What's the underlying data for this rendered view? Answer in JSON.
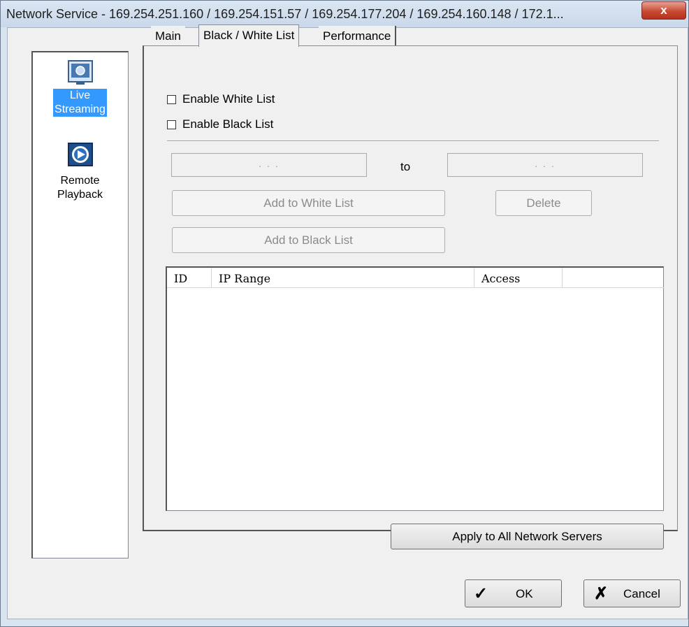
{
  "window": {
    "title": "Network Service - 169.254.251.160 / 169.254.151.57 / 169.254.177.204 / 169.254.160.148 / 172.1...",
    "close_label": "x"
  },
  "nav": {
    "items": [
      {
        "label_line1": "Live",
        "label_line2": "Streaming",
        "icon": "monitor-icon",
        "selected": true
      },
      {
        "label_line1": "Remote",
        "label_line2": "Playback",
        "icon": "play-icon",
        "selected": false
      }
    ]
  },
  "tabs": [
    {
      "label": "Main"
    },
    {
      "label": "Black / White List"
    },
    {
      "label": "Performance"
    }
  ],
  "options": {
    "enable_white_list": "Enable White List",
    "enable_black_list": "Enable Black List"
  },
  "ip_range": {
    "start_value": ". . .",
    "end_value": ". . .",
    "to_label": "to"
  },
  "buttons": {
    "add_white": "Add to White List",
    "add_black": "Add to Black List",
    "delete": "Delete",
    "apply_all": "Apply to All Network Servers",
    "ok": "OK",
    "cancel": "Cancel"
  },
  "list": {
    "columns": [
      "ID",
      "IP Range",
      "Access",
      ""
    ]
  },
  "colors": {
    "selection": "#3399ff",
    "close_button": "#c84a33"
  }
}
